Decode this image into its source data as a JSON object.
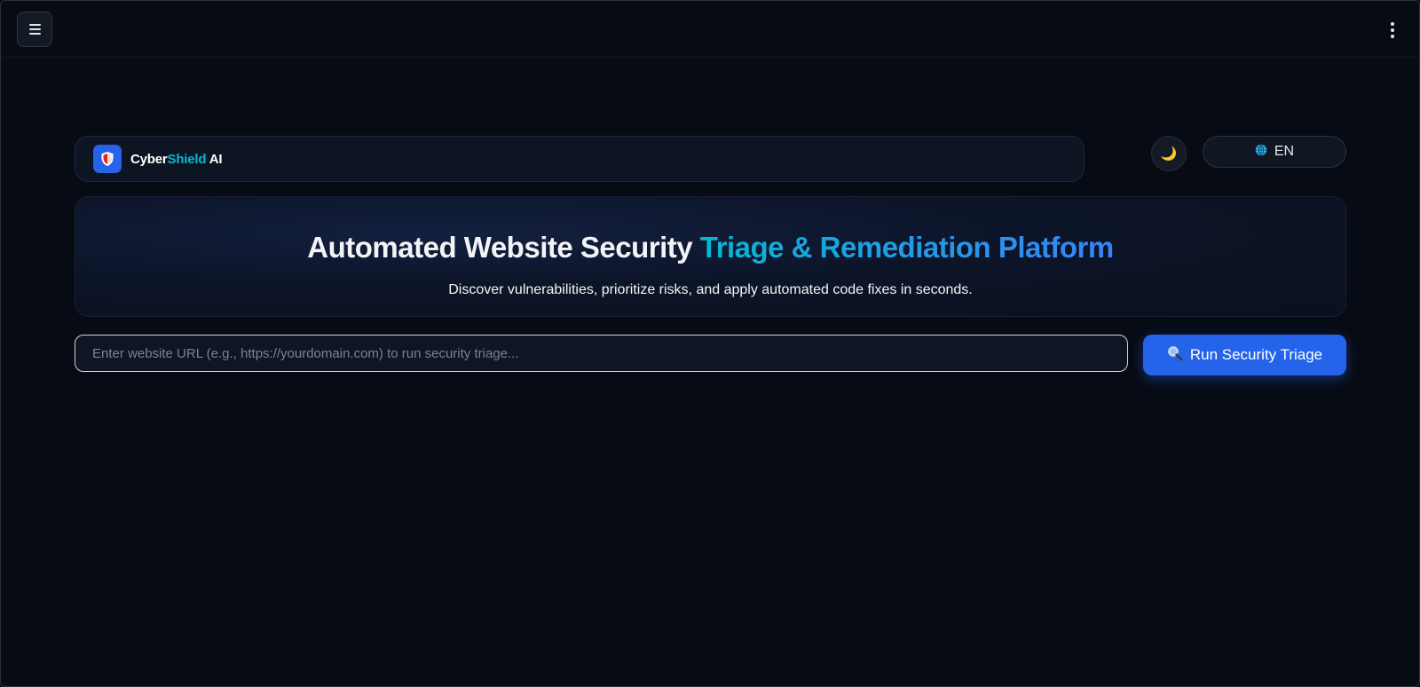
{
  "topbar": {
    "menu_icon": "hamburger-icon",
    "more_icon": "kebab-vertical-icon"
  },
  "brand": {
    "name_part1": "Cyber",
    "name_part2": "Shield",
    "name_part3": " AI",
    "logo_icon": "shield-icon",
    "accent_color": "#06b6d4"
  },
  "controls": {
    "theme_icon": "moon-icon",
    "theme_glyph": "🌙",
    "language_icon": "globe-icon",
    "language_label": "EN"
  },
  "hero": {
    "title_main": "Automated Website Security ",
    "title_accent": "Triage & Remediation Platform",
    "subtitle": "Discover vulnerabilities, prioritize risks, and apply automated code fixes in seconds."
  },
  "scan": {
    "url_placeholder": "Enter website URL (e.g., https://yourdomain.com) to run security triage...",
    "url_value": "",
    "run_icon": "magnifier-icon",
    "run_label": "Run Security Triage",
    "button_color": "#2563eb"
  }
}
